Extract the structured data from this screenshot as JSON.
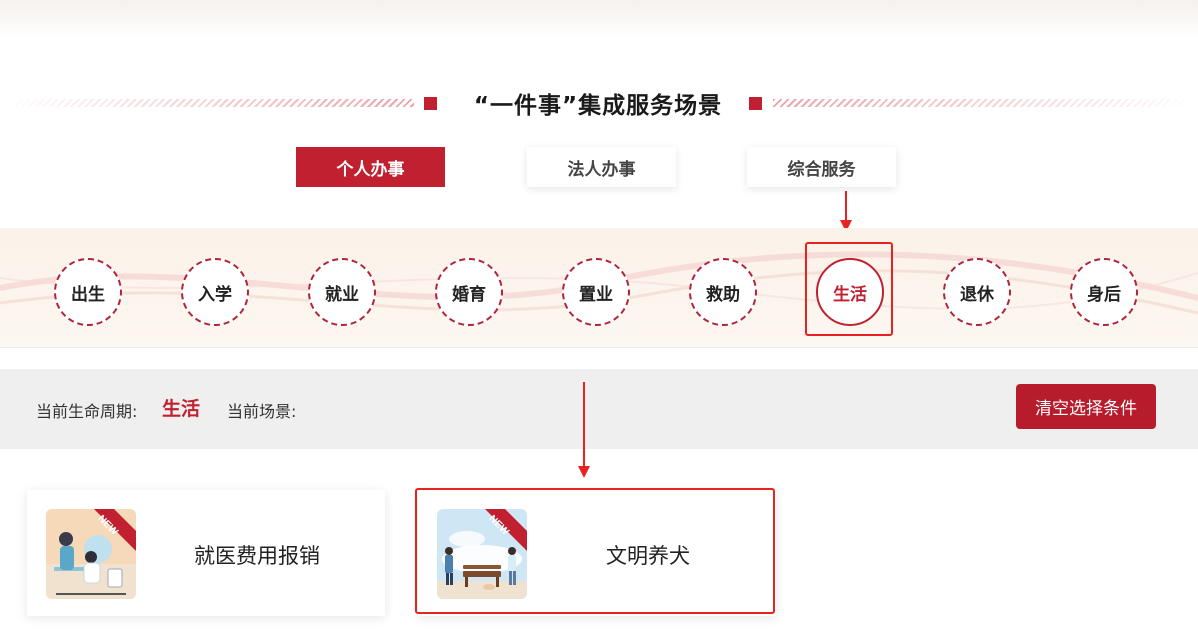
{
  "section": {
    "title": "“一件事”集成服务场景"
  },
  "tabs": [
    {
      "label": "个人办事",
      "active": true
    },
    {
      "label": "法人办事",
      "active": false
    },
    {
      "label": "综合服务",
      "active": false
    }
  ],
  "stages": [
    {
      "label": "出生"
    },
    {
      "label": "入学"
    },
    {
      "label": "就业"
    },
    {
      "label": "婚育"
    },
    {
      "label": "置业"
    },
    {
      "label": "救助"
    },
    {
      "label": "生活",
      "active": true
    },
    {
      "label": "退休"
    },
    {
      "label": "身后"
    }
  ],
  "status": {
    "lifecycle_label": "当前生命周期:",
    "lifecycle_value": "生活",
    "scene_label": "当前场景:",
    "clear_button": "清空选择条件"
  },
  "cards": [
    {
      "title": "就医费用报销",
      "badge": "NEW"
    },
    {
      "title": "文明养犬",
      "badge": "NEW"
    }
  ],
  "colors": {
    "accent": "#c0202f",
    "annotation": "#e8231f"
  }
}
